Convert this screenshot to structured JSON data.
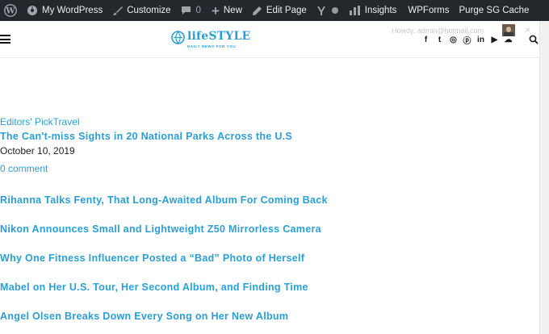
{
  "admin_bar": {
    "site_name": "My WordPress",
    "customize": "Customize",
    "comments_count": "0",
    "new_label": "New",
    "edit_page": "Edit Page",
    "insights": "Insights",
    "wpforms": "WPForms",
    "purge": "Purge SG Cache"
  },
  "header": {
    "logo_title": "lifeSTYLE",
    "logo_tagline": "DAILY NEWS FOR YOU",
    "user_email": "Howdy, admin@hotmail.com",
    "social_icons": [
      "facebook-icon",
      "twitter-icon",
      "instagram-icon",
      "pinterest-icon",
      "linkedin-icon",
      "youtube-icon",
      "soundcloud-icon"
    ],
    "social_glyphs": [
      "f",
      "t",
      "◎",
      "ⓟ",
      "in",
      "▶",
      "☁"
    ]
  },
  "featured": {
    "categories": "Editors' PickTravel",
    "title": "The Can't-miss Sights in 20 National Parks Across the U.S",
    "date": "October 10, 2019",
    "comments": "0 comment"
  },
  "posts": [
    "Rihanna Talks Fenty, That Long-Awaited Album For Coming Back",
    "Nikon Announces Small and Lightweight Z50 Mirrorless Camera",
    "Why One Fitness Influencer Posted a “Bad” Photo of Herself",
    "Mabel on Her U.S. Tour, Her Second Album, and Finding Time",
    "Angel Olsen Breaks Down Every Song on Her New Album"
  ],
  "colors": {
    "accent": "#2b9fd4",
    "admin_bar_bg": "#23282d"
  }
}
